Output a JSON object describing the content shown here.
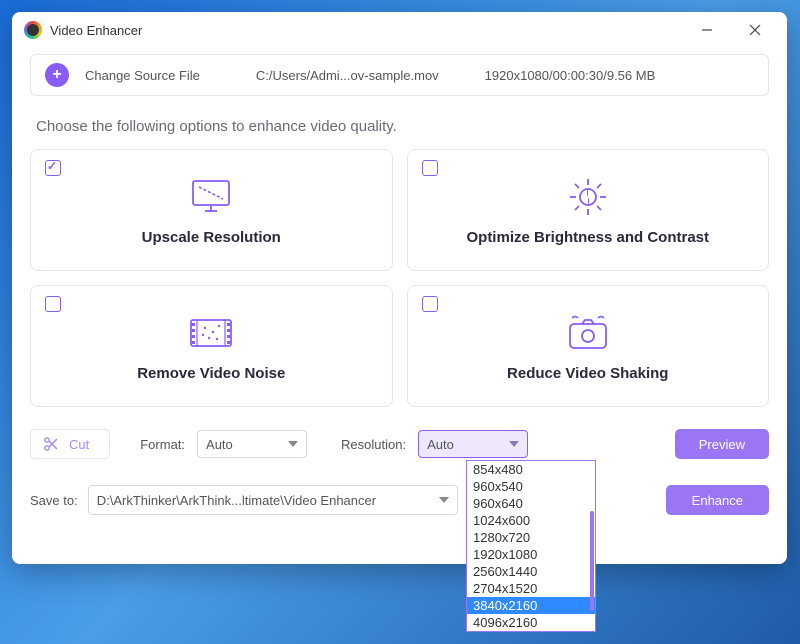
{
  "window": {
    "title": "Video Enhancer"
  },
  "source": {
    "change_label": "Change Source File",
    "path": "C:/Users/Admi...ov-sample.mov",
    "meta": "1920x1080/00:00:30/9.56 MB"
  },
  "instruction": "Choose the following options to enhance video quality.",
  "cards": [
    {
      "title": "Upscale Resolution",
      "checked": true
    },
    {
      "title": "Optimize Brightness and Contrast",
      "checked": false
    },
    {
      "title": "Remove Video Noise",
      "checked": false
    },
    {
      "title": "Reduce Video Shaking",
      "checked": false
    }
  ],
  "controls": {
    "cut_label": "Cut",
    "format_label": "Format:",
    "format_value": "Auto",
    "resolution_label": "Resolution:",
    "resolution_value": "Auto",
    "preview_label": "Preview"
  },
  "save": {
    "label": "Save to:",
    "path": "D:\\ArkThinker\\ArkThink...ltimate\\Video Enhancer",
    "enhance_label": "Enhance"
  },
  "resolution_options": [
    "854x480",
    "960x540",
    "960x640",
    "1024x600",
    "1280x720",
    "1920x1080",
    "2560x1440",
    "2704x1520",
    "3840x2160",
    "4096x2160"
  ],
  "resolution_highlight_index": 8
}
